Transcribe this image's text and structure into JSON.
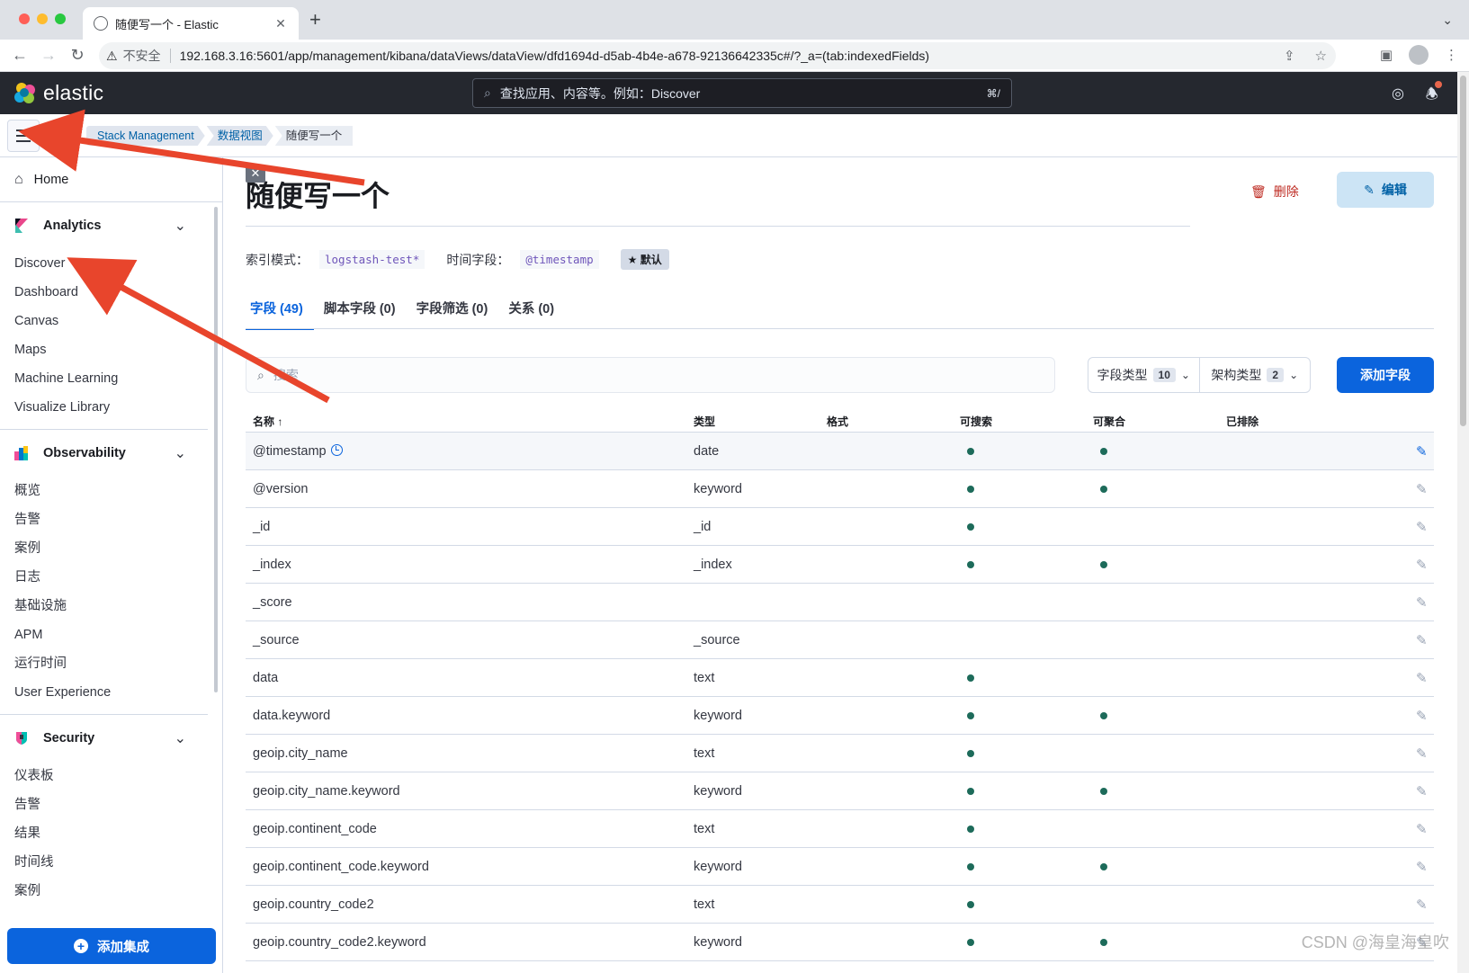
{
  "browser": {
    "tab_title": "随便写一个 - Elastic",
    "new_tab": "+",
    "insecure_label": "不安全",
    "url": "192.168.3.16:5601/app/management/kibana/dataViews/dataView/dfd1694d-d5ab-4b4e-a678-92136642335c#/?_a=(tab:indexedFields)"
  },
  "kibana_header": {
    "logo_text": "elastic",
    "search_placeholder": "查找应用、内容等。例如：Discover",
    "search_shortcut": "⌘/"
  },
  "breadcrumbs": [
    "Stack Management",
    "数据视图",
    "随便写一个"
  ],
  "space_badge": "#",
  "sidebar": {
    "home": "Home",
    "groups": [
      {
        "title": "Analytics",
        "items": [
          "Discover",
          "Dashboard",
          "Canvas",
          "Maps",
          "Machine Learning",
          "Visualize Library"
        ]
      },
      {
        "title": "Observability",
        "items": [
          "概览",
          "告警",
          "案例",
          "日志",
          "基础设施",
          "APM",
          "运行时间",
          "User Experience"
        ]
      },
      {
        "title": "Security",
        "items": [
          "仪表板",
          "告警",
          "结果",
          "时间线",
          "案例"
        ]
      }
    ],
    "add_integration": "添加集成"
  },
  "page": {
    "title": "随便写一个",
    "delete_label": "删除",
    "edit_label": "编辑",
    "index_pattern_label": "索引模式：",
    "index_pattern_value": "logstash-test*",
    "time_field_label": "时间字段：",
    "time_field_value": "@timestamp",
    "default_badge": "默认"
  },
  "tabs": [
    "字段 (49)",
    "脚本字段 (0)",
    "字段筛选 (0)",
    "关系 (0)"
  ],
  "toolbar": {
    "search_placeholder": "搜索",
    "field_type_label": "字段类型",
    "field_type_count": "10",
    "schema_type_label": "架构类型",
    "schema_type_count": "2",
    "add_field_label": "添加字段"
  },
  "table": {
    "headers": {
      "name": "名称",
      "type": "类型",
      "format": "格式",
      "searchable": "可搜索",
      "aggregatable": "可聚合",
      "excluded": "已排除"
    },
    "rows": [
      {
        "name": "@timestamp",
        "type": "date",
        "searchable": true,
        "aggregatable": true,
        "time_field": true
      },
      {
        "name": "@version",
        "type": "keyword",
        "searchable": true,
        "aggregatable": true
      },
      {
        "name": "_id",
        "type": "_id",
        "searchable": true,
        "aggregatable": false
      },
      {
        "name": "_index",
        "type": "_index",
        "searchable": true,
        "aggregatable": true
      },
      {
        "name": "_score",
        "type": "",
        "searchable": false,
        "aggregatable": false
      },
      {
        "name": "_source",
        "type": "_source",
        "searchable": false,
        "aggregatable": false
      },
      {
        "name": "data",
        "type": "text",
        "searchable": true,
        "aggregatable": false
      },
      {
        "name": "data.keyword",
        "type": "keyword",
        "searchable": true,
        "aggregatable": true
      },
      {
        "name": "geoip.city_name",
        "type": "text",
        "searchable": true,
        "aggregatable": false
      },
      {
        "name": "geoip.city_name.keyword",
        "type": "keyword",
        "searchable": true,
        "aggregatable": true
      },
      {
        "name": "geoip.continent_code",
        "type": "text",
        "searchable": true,
        "aggregatable": false
      },
      {
        "name": "geoip.continent_code.keyword",
        "type": "keyword",
        "searchable": true,
        "aggregatable": true
      },
      {
        "name": "geoip.country_code2",
        "type": "text",
        "searchable": true,
        "aggregatable": false
      },
      {
        "name": "geoip.country_code2.keyword",
        "type": "keyword",
        "searchable": true,
        "aggregatable": true
      }
    ]
  },
  "watermark": "CSDN @海皇海皇吹",
  "colors": {
    "primary": "#0b64dd",
    "danger": "#bd271e",
    "header_bg": "#25282f",
    "dot": "#1d6b5a",
    "annotation_arrow": "#e8452c"
  }
}
